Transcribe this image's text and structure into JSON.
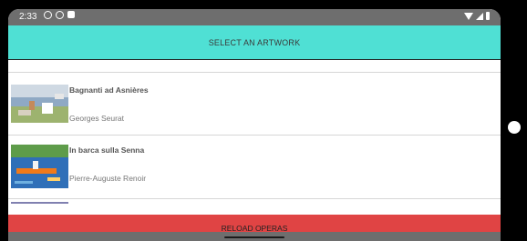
{
  "status_bar": {
    "time": "2:33",
    "left_icons": [
      "info-icon",
      "shield-icon",
      "notification-icon"
    ],
    "right_icons": [
      "wifi-icon",
      "signal-icon",
      "battery-icon"
    ]
  },
  "app_bar": {
    "title": "SELECT AN ARTWORK"
  },
  "artworks": [
    {
      "title": "Bagnanti ad Asnières",
      "artist": "Georges Seurat"
    },
    {
      "title": "In barca sulla Senna",
      "artist": "Pierre-Auguste Renoir"
    }
  ],
  "reload_button": {
    "label": "RELOAD OPERAS"
  },
  "colors": {
    "app_bar": "#4fe0d4",
    "reload_button": "#e04444",
    "status_bar": "#6e6e6e"
  }
}
